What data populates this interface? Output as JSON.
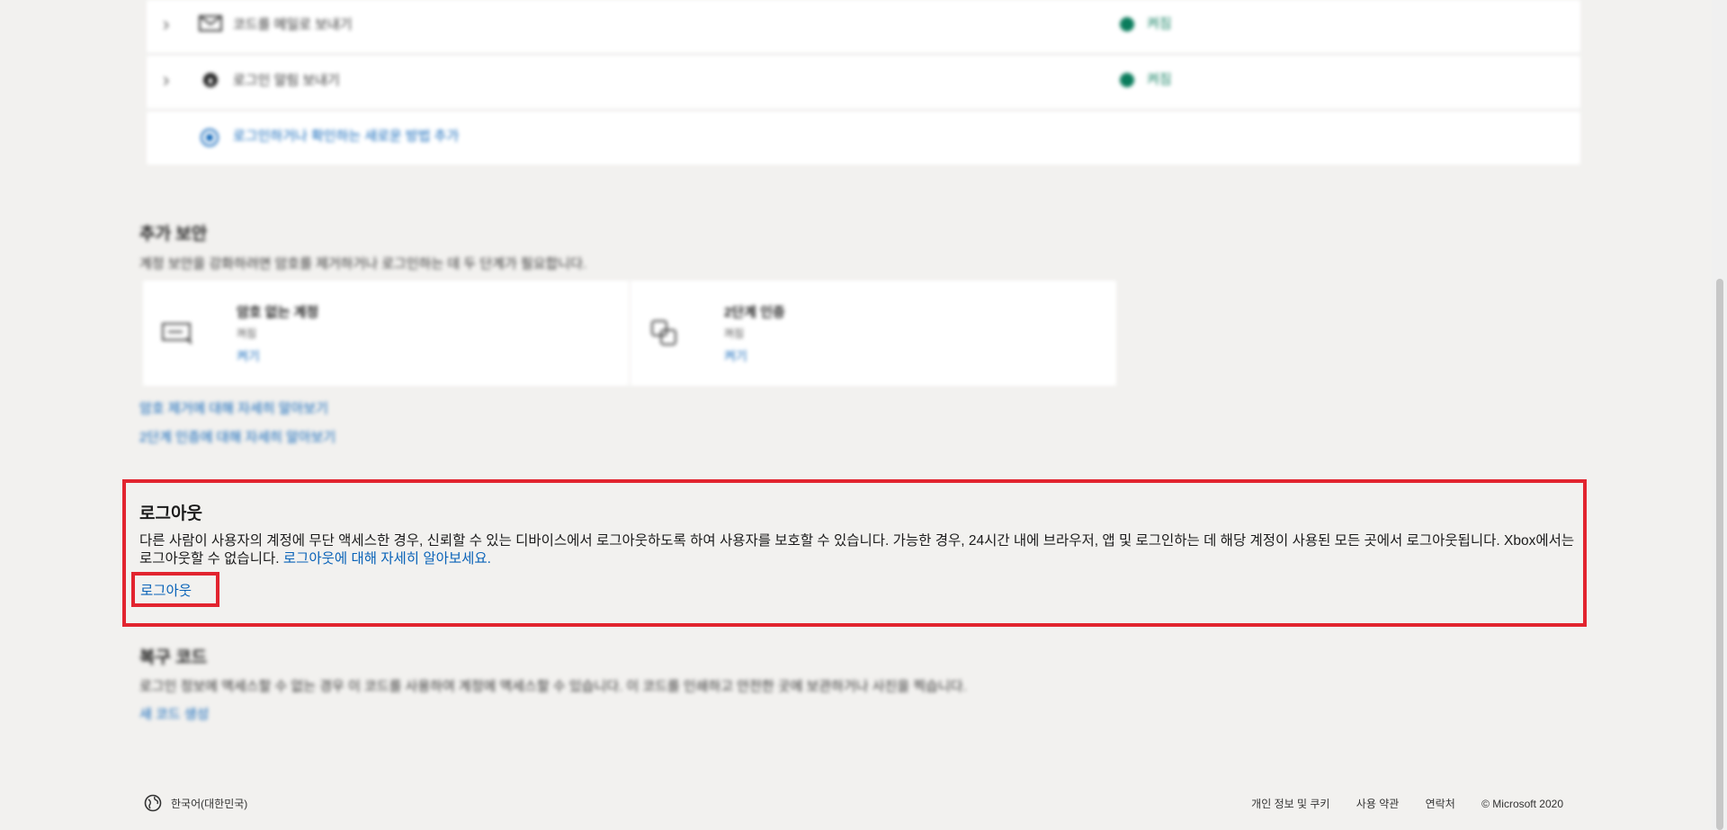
{
  "methods": [
    {
      "label": "코드를 메일로 보내기",
      "status": "켜짐",
      "icon": "mail-icon"
    },
    {
      "label": "로그인 알림 보내기",
      "status": "켜짐",
      "icon": "lock-icon"
    }
  ],
  "add_method_label": "로그인하거나 확인하는 새로운 방법 추가",
  "additional_security": {
    "title": "추가 보안",
    "description": "계정 보안을 강화하려면 암호를 제거하거나 로그인하는 데 두 단계가 필요합니다.",
    "cards": [
      {
        "title": "암호 없는 계정",
        "state": "꺼짐",
        "action": "켜기",
        "icon": "passwordless-icon"
      },
      {
        "title": "2단계 인증",
        "state": "꺼짐",
        "action": "켜기",
        "icon": "two-step-icon"
      }
    ],
    "learn_links": [
      "암호 제거에 대해 자세히 알아보기",
      "2단계 인증에 대해 자세히 알아보기"
    ]
  },
  "logout": {
    "title": "로그아웃",
    "description": "다른 사람이 사용자의 계정에 무단 액세스한 경우, 신뢰할 수 있는 디바이스에서 로그아웃하도록 하여 사용자를 보호할 수 있습니다. 가능한 경우, 24시간 내에 브라우저, 앱 및 로그인하는 데 해당 계정이 사용된 모든 곳에서 로그아웃됩니다. Xbox에서는 로그아웃할 수 없습니다.",
    "learn_link": "로그아웃에 대해 자세히 알아보세요.",
    "button": "로그아웃"
  },
  "recovery": {
    "title": "복구 코드",
    "description": "로그인 정보에 액세스할 수 없는 경우 이 코드를 사용하여 계정에 액세스할 수 있습니다. 이 코드를 인쇄하고 안전한 곳에 보관하거나 사진을 찍습니다.",
    "link": "새 코드 생성"
  },
  "footer": {
    "language": "한국어(대한민국)",
    "links": [
      "개인 정보 및 쿠키",
      "사용 약관",
      "연락처"
    ],
    "copyright": "© Microsoft 2020"
  },
  "colors": {
    "highlight": "#e2242f",
    "link": "#0a63b8",
    "status_on": "#0a7c5c",
    "background": "#f2f1ef"
  }
}
